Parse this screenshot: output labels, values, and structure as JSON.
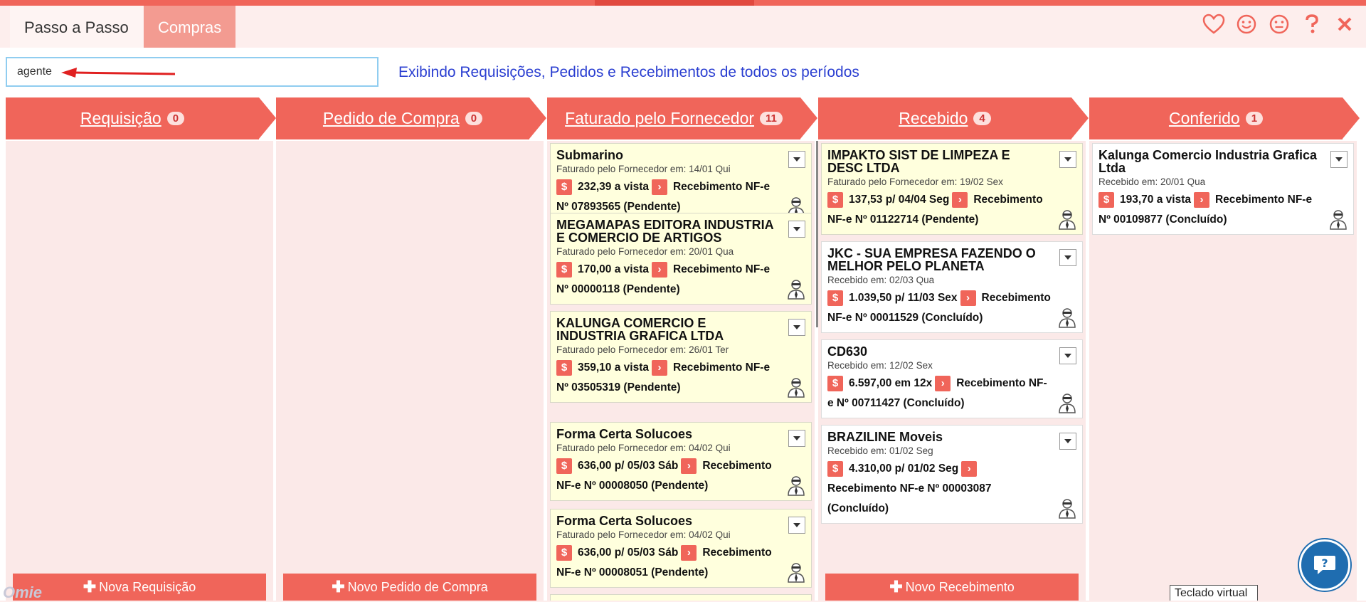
{
  "nav": {
    "tab1": "Passo a Passo",
    "tab2": "Compras"
  },
  "top_icons": [
    "heart-icon",
    "smile-icon",
    "neutral-face-icon",
    "help-icon",
    "close-icon"
  ],
  "search": {
    "value": "agente",
    "placeholder": ""
  },
  "info_text": "Exibindo Requisições, Pedidos e Recebimentos de todos os períodos",
  "columns": [
    {
      "title": "Requisição",
      "count": "0",
      "button": "Nova Requisição"
    },
    {
      "title": "Pedido de Compra",
      "count": "0",
      "button": "Novo Pedido de Compra"
    },
    {
      "title": "Faturado pelo Fornecedor",
      "count": "11"
    },
    {
      "title": "Recebido",
      "count": "4",
      "button": "Novo Recebimento"
    },
    {
      "title": "Conferido",
      "count": "1"
    }
  ],
  "cards_faturado": [
    {
      "name": "Submarino",
      "date": "Faturado pelo Fornecedor em: 14/01 Qui",
      "value": "232,39 a vista",
      "action": "Recebimento NF-e Nº 07893565 (Pendente)"
    },
    {
      "name": "MEGAMAPAS EDITORA INDUSTRIA E COMERCIO DE ARTIGOS",
      "date": "Faturado pelo Fornecedor em: 20/01 Qua",
      "value": "170,00 a vista",
      "action": "Recebimento NF-e Nº 00000118 (Pendente)"
    },
    {
      "name": "KALUNGA COMERCIO E INDUSTRIA GRAFICA LTDA",
      "date": "Faturado pelo Fornecedor em: 26/01 Ter",
      "value": "359,10 a vista",
      "action": "Recebimento NF-e Nº 03505319 (Pendente)"
    },
    {
      "name": "Forma Certa Solucoes",
      "date": "Faturado pelo Fornecedor em: 04/02 Qui",
      "value": "636,00 p/ 05/03 Sáb",
      "action": "Recebimento NF-e Nº 00008050 (Pendente)"
    },
    {
      "name": "Forma Certa Solucoes",
      "date": "Faturado pelo Fornecedor em: 04/02 Qui",
      "value": "636,00 p/ 05/03 Sáb",
      "action": "Recebimento NF-e Nº 00008051 (Pendente)"
    }
  ],
  "cards_recebido": [
    {
      "name": "IMPAKTO SIST DE LIMPEZA E DESC LTDA",
      "date": "Faturado pelo Fornecedor em: 19/02 Sex",
      "value": "137,53 p/ 04/04 Seg",
      "action": "Recebimento NF-e Nº 01122714 (Pendente)"
    },
    {
      "name": "JKC - SUA EMPRESA FAZENDO O MELHOR PELO PLANETA",
      "date": "Recebido em: 02/03 Qua",
      "value": "1.039,50 p/ 11/03 Sex",
      "action": "Recebimento NF-e Nº 00011529 (Concluído)"
    },
    {
      "name": "CD630",
      "date": "Recebido em: 12/02 Sex",
      "value": "6.597,00 em 12x",
      "action": "Recebimento NF-e Nº 00711427 (Concluído)"
    },
    {
      "name": "BRAZILINE Moveis",
      "date": "Recebido em: 01/02 Seg",
      "value": "4.310,00 p/ 01/02 Seg",
      "action": "Recebimento NF-e Nº 00003087 (Concluído)"
    }
  ],
  "cards_conferido": [
    {
      "name": "Kalunga Comercio Industria Grafica Ltda",
      "date": "Recebido em: 20/01 Qua",
      "value": "193,70 a vista",
      "action": "Recebimento NF-e Nº 00109877 (Concluído)"
    }
  ],
  "footer": {
    "virtual_keyboard": "Teclado virtual",
    "logo": "Omie"
  },
  "colors": {
    "accent": "#f0655a",
    "pending_card": "#ffffdd",
    "link_blue": "#2b3fd1"
  }
}
